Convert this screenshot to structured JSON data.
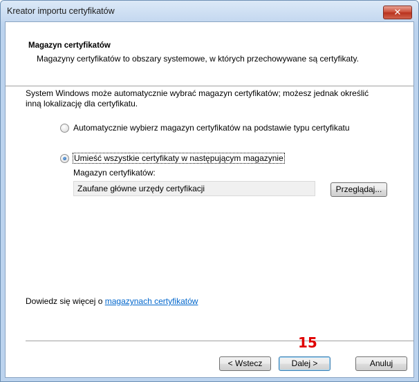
{
  "window": {
    "title": "Kreator importu certyfikatów",
    "close_symbol": "✕"
  },
  "header": {
    "title": "Magazyn certyfikatów",
    "description": "Magazyny certyfikatów to obszary systemowe, w których przechowywane są certyfikaty."
  },
  "body": {
    "intro": "System Windows może automatycznie wybrać magazyn certyfikatów; możesz jednak określić inną lokalizację dla certyfikatu.",
    "options": [
      {
        "label": "Automatycznie wybierz magazyn certyfikatów na podstawie typu certyfikatu",
        "checked": false
      },
      {
        "label": "Umieść wszystkie certyfikaty w następującym magazynie",
        "checked": true
      }
    ],
    "store_label": "Magazyn certyfikatów:",
    "store_value": "Zaufane główne urzędy certyfikacji",
    "browse_label": "Przeglądaj..."
  },
  "learn_more": {
    "prefix": "Dowiedz się więcej o ",
    "link": "magazynach certyfikatów"
  },
  "annotation": {
    "step": "15"
  },
  "footer": {
    "back_label": "< Wstecz",
    "next_label": "Dalej >",
    "cancel_label": "Anuluj"
  }
}
